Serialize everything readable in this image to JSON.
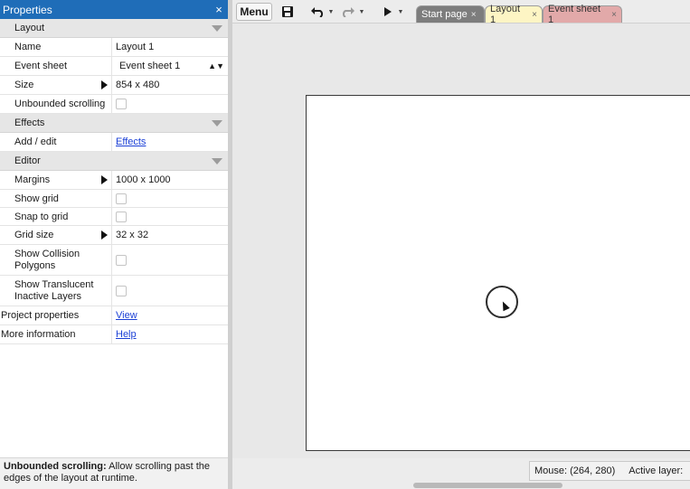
{
  "panel": {
    "title": "Properties",
    "close": "×",
    "sections": {
      "layout": "Layout",
      "effects": "Effects",
      "editor": "Editor"
    },
    "rows": {
      "name": {
        "label": "Name",
        "value": "Layout 1"
      },
      "event_sheet": {
        "label": "Event sheet",
        "value": "Event sheet 1"
      },
      "size": {
        "label": "Size",
        "value": "854 x 480"
      },
      "unbounded": {
        "label": "Unbounded scrolling",
        "checked": false
      },
      "add_edit": {
        "label": "Add / edit",
        "link": "Effects"
      },
      "margins": {
        "label": "Margins",
        "value": "1000 x 1000"
      },
      "show_grid": {
        "label": "Show grid",
        "checked": false
      },
      "snap_grid": {
        "label": "Snap to grid",
        "checked": false
      },
      "grid_size": {
        "label": "Grid size",
        "value": "32 x 32"
      },
      "collision_l1": "Show Collision",
      "collision_l2": "Polygons",
      "translucent_l1": "Show Translucent",
      "translucent_l2": "Inactive Layers",
      "project": {
        "label": "Project properties",
        "link": "View"
      },
      "more": {
        "label": "More information",
        "link": "Help"
      }
    },
    "help": {
      "title": "Unbounded scrolling:",
      "text": " Allow scrolling past the edges of the layout at runtime."
    }
  },
  "toolbar": {
    "menu": "Menu",
    "icons": [
      "save-icon",
      "undo-icon",
      "redo-icon",
      "play-icon"
    ],
    "tabs": [
      {
        "label": "Start page",
        "close": "×"
      },
      {
        "label": "Layout 1",
        "close": "×"
      },
      {
        "label": "Event sheet 1",
        "close": "×"
      }
    ]
  },
  "status": {
    "mouse": "Mouse: (264, 280)",
    "active_layer": "Active layer:"
  }
}
